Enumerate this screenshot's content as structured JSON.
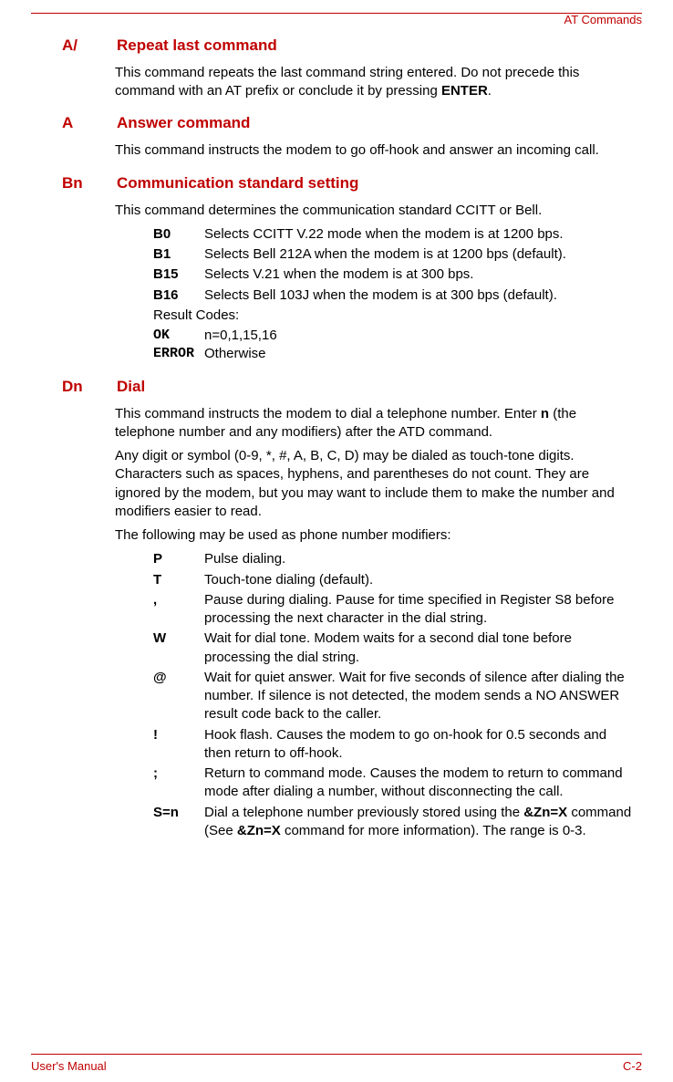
{
  "header": {
    "title": "AT Commands"
  },
  "footer": {
    "left": "User's Manual",
    "right": "C-2"
  },
  "sections": {
    "s0": {
      "sym": "A/",
      "title": "Repeat last command",
      "p1a": "This command repeats the last command string entered. Do not precede this command with an AT prefix or conclude it by pressing ",
      "p1b": "ENTER",
      "p1c": "."
    },
    "s1": {
      "sym": "A",
      "title": "Answer command",
      "p1": "This command instructs the modem to go off-hook and answer an incoming call."
    },
    "s2": {
      "sym": "Bn",
      "title": "Communication standard setting",
      "p1": "This command determines the communication standard CCITT or Bell.",
      "rows": {
        "r0": {
          "k": "B0",
          "v": "Selects CCITT V.22 mode when the modem is at 1200 bps."
        },
        "r1": {
          "k": "B1",
          "v": "Selects Bell 212A when the modem is at 1200 bps (default)."
        },
        "r2": {
          "k": "B15",
          "v": "Selects V.21 when the modem is at 300 bps."
        },
        "r3": {
          "k": "B16",
          "v": "Selects Bell 103J when the modem is at 300 bps (default)."
        }
      },
      "rc_label": "Result Codes:",
      "rc": {
        "r0": {
          "k": "OK",
          "v": "n=0,1,15,16"
        },
        "r1": {
          "k": "ERROR",
          "v": "Otherwise"
        }
      }
    },
    "s3": {
      "sym": "Dn",
      "title": "Dial",
      "p1a": "This command instructs the modem to dial a telephone number. Enter ",
      "p1b": "n",
      "p1c": " (the telephone number and any modifiers) after the ATD command.",
      "p2": "Any digit or symbol (0-9, *, #, A, B, C, D) may be dialed as touch-tone digits. Characters such as spaces, hyphens, and parentheses do not count. They are ignored by the modem, but you may want to include them to make the number and modifiers easier to read.",
      "p3": "The following may be used as phone number modifiers:",
      "rows": {
        "r0": {
          "k": "P",
          "v": "Pulse dialing."
        },
        "r1": {
          "k": "T",
          "v": "Touch-tone dialing (default)."
        },
        "r2": {
          "k": ",",
          "v": "Pause during dialing. Pause for time specified in Register S8 before processing the next character in the dial string."
        },
        "r3": {
          "k": "W",
          "v": "Wait for dial tone. Modem waits for a second dial tone before processing the dial string."
        },
        "r4": {
          "k": "@",
          "v": "Wait for quiet answer. Wait for five seconds of silence after dialing the number. If silence is not detected, the modem sends a NO ANSWER result code back to the caller."
        },
        "r5": {
          "k": "!",
          "v": "Hook flash. Causes the modem to go on-hook for 0.5 seconds and then return to off-hook."
        },
        "r6": {
          "k": ";",
          "v": "Return to command mode. Causes the modem to return to command mode after dialing a number, without disconnecting the call."
        },
        "r7": {
          "k": "S=n",
          "va": "Dial a telephone number previously stored using the ",
          "vb": "&Zn=X",
          "vc": " command (See ",
          "vd": "&Zn=X",
          "ve": " command for more information). The range is 0-3."
        }
      }
    }
  }
}
